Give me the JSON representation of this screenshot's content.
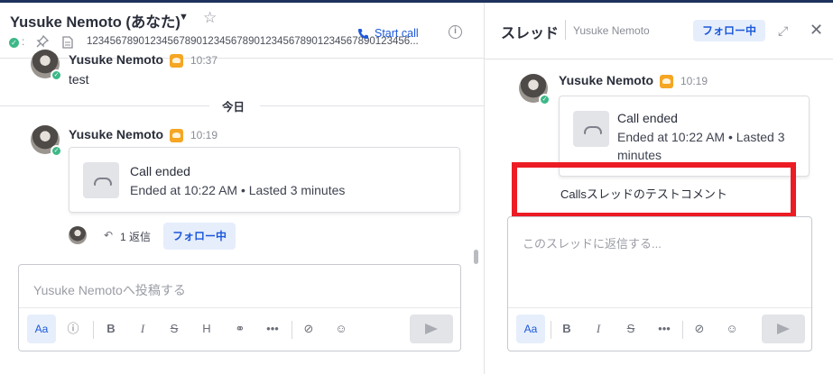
{
  "channel": {
    "title": "Yusuke Nemoto (あなた)",
    "purpose": "12345678901234567890123456789012345678901234567890123456...",
    "status_symbol": "✓",
    "start_call_label": "Start call"
  },
  "messages": [
    {
      "author": "Yusuke Nemoto",
      "time": "10:37",
      "text": "test"
    },
    {
      "author": "Yusuke Nemoto",
      "time": "10:19"
    }
  ],
  "date_separator": "今日",
  "call": {
    "title": "Call ended",
    "subtitle": "Ended at 10:22 AM • Lasted 3 minutes"
  },
  "thread_summary": {
    "reply_count": "1 返信",
    "follow_label": "フォロー中"
  },
  "composer": {
    "placeholder": "Yusuke Nemotoへ投稿する",
    "format_label": "Aa",
    "toolbar": [
      "B",
      "I",
      "S",
      "H",
      "link",
      "more",
      "attach",
      "emoji"
    ]
  },
  "thread": {
    "title": "スレッド",
    "channel": "Yusuke Nemoto",
    "follow_label": "フォロー中",
    "root": {
      "author": "Yusuke Nemoto",
      "time": "10:19",
      "call_title": "Call ended",
      "call_subtitle": "Ended at 10:22 AM • Lasted 3 minutes"
    },
    "reply_text": "Callsスレッドのテストコメント",
    "composer_placeholder": "このスレッドに返信する..."
  },
  "colors": {
    "accent": "#1c58d9",
    "online": "#3db887",
    "highlight": "#ec1c24",
    "topbar": "#1e325c"
  }
}
